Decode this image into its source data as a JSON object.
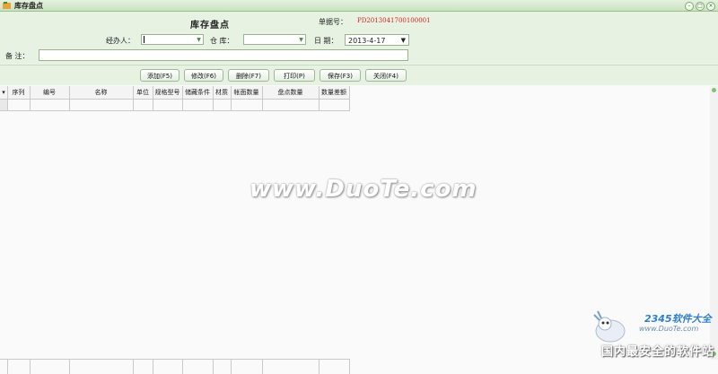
{
  "window": {
    "title": "库存盘点"
  },
  "form": {
    "title": "库存盘点",
    "bill_no_label": "单据号：",
    "bill_no_value": "PD2013041700100001",
    "handler_label": "经办人：",
    "handler_value": "",
    "warehouse_label": "仓 库：",
    "warehouse_value": "",
    "date_label": "日 期：",
    "date_value": "2013-4-17",
    "remark_label": "备 注：",
    "remark_value": ""
  },
  "toolbar": {
    "add": "添加(F5)",
    "edit": "修改(F6)",
    "delete": "删除(F7)",
    "print": "打印(P)",
    "save": "保存(F3)",
    "close": "关闭(F4)"
  },
  "grid": {
    "row_marker": "▾",
    "columns": [
      "序列",
      "编号",
      "名称",
      "单位",
      "规格型号",
      "储藏条件",
      "材质",
      "帐面数量",
      "盘点数量",
      "数量差额"
    ]
  },
  "watermarks": {
    "center": "www.DuoTe.com",
    "corner_brand": "2345软件大全",
    "corner_url": "www.DuoTe.com",
    "corner_slogan": "国内最安全的软件站"
  },
  "colors": {
    "accent_green": "#c9e3c1",
    "bill_no_red": "#dd2222"
  }
}
